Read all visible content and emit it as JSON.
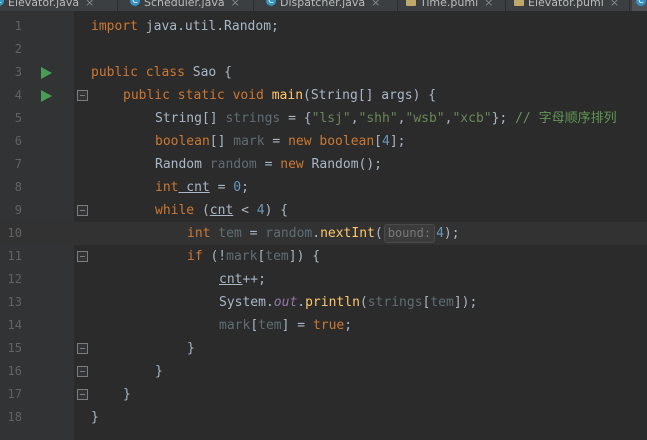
{
  "tabs": [
    {
      "label": "Elevator.java",
      "icon": "c-java-icon",
      "type": "java",
      "close": "×"
    },
    {
      "label": "Scheduler.java",
      "icon": "c-java-icon",
      "type": "java",
      "close": "×"
    },
    {
      "label": "Dispatcher.java",
      "icon": "c-java-icon",
      "type": "java",
      "close": "×"
    },
    {
      "label": "Time.puml",
      "icon": "puml-file-icon",
      "type": "puml",
      "close": "×"
    },
    {
      "label": "Elevator.puml",
      "icon": "puml-file-icon",
      "type": "puml",
      "close": "×"
    }
  ],
  "line_numbers": [
    "1",
    "2",
    "3",
    "4",
    "5",
    "6",
    "7",
    "8",
    "9",
    "10",
    "11",
    "12",
    "13",
    "14",
    "15",
    "16",
    "17",
    "18"
  ],
  "code": {
    "l1": {
      "kw": "import",
      "rest": " java.util.Random;"
    },
    "l3": {
      "kw": "public class",
      "name": " Sao ",
      "brace": "{"
    },
    "l4": {
      "kw": "public static void",
      "fn": " main",
      "rest": "(String[] args) {"
    },
    "l5": {
      "type": "String[] ",
      "var": "strings",
      "mid": " = {",
      "s1": "\"lsj\"",
      "s2": "\"shh\"",
      "s3": "\"wsb\"",
      "s4": "\"xcb\"",
      "end": "}; ",
      "comment": "// 字母顺序排列"
    },
    "l6": {
      "kw": "boolean",
      "rest1": "[] ",
      "var": "mark",
      "mid": " = ",
      "kw2": "new boolean",
      "lb": "[",
      "num": "4",
      "rb": "];"
    },
    "l7": {
      "type": "Random ",
      "var": "random",
      "mid": " = ",
      "kw": "new",
      "cls": " Random",
      "end": "();"
    },
    "l8": {
      "kw": "int",
      "var": " cnt",
      "mid": " = ",
      "num": "0",
      "end": ";"
    },
    "l9": {
      "kw": "while",
      "open": " (",
      "var": "cnt",
      "mid": " < ",
      "num": "4",
      "end": ") {"
    },
    "l10": {
      "kw": "int",
      "var": " tem",
      "mid": " = ",
      "obj": "random",
      "dot": ".",
      "fn": "nextInt",
      "open": "(",
      "hint": "bound:",
      "num": "4",
      "end": ");"
    },
    "l11": {
      "kw": "if",
      "open": " (!",
      "var": "mark",
      "lb": "[",
      "idx": "tem",
      "end": "]) {"
    },
    "l12": {
      "var": "cnt",
      "end": "++;"
    },
    "l13": {
      "cls": "System",
      "dot": ".",
      "field": "out",
      "dot2": ".",
      "fn": "println",
      "open": "(",
      "var": "strings",
      "lb": "[",
      "idx": "tem",
      "end": "]);"
    },
    "l14": {
      "var": "mark",
      "lb": "[",
      "idx": "tem",
      "mid": "] = ",
      "kw": "true",
      "end": ";"
    },
    "l15": {
      "brace": "}"
    },
    "l16": {
      "brace": "}"
    },
    "l17": {
      "brace": "}"
    },
    "l18": {
      "brace": "}"
    }
  }
}
